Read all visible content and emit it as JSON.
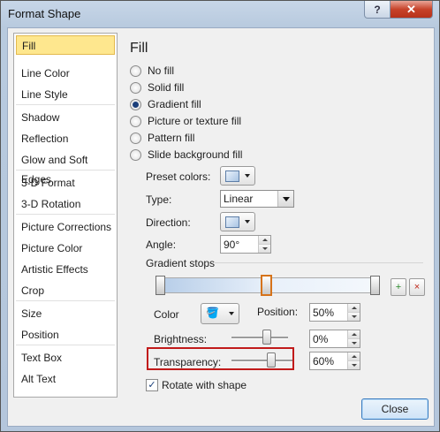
{
  "window": {
    "title": "Format Shape",
    "help_glyph": "?",
    "close_glyph": "✕"
  },
  "nav": {
    "items": [
      {
        "label": "Fill",
        "selected": true
      },
      {
        "label": "Line Color"
      },
      {
        "label": "Line Style"
      },
      {
        "label": "Shadow"
      },
      {
        "label": "Reflection"
      },
      {
        "label": "Glow and Soft Edges"
      },
      {
        "label": "3-D Format"
      },
      {
        "label": "3-D Rotation"
      },
      {
        "label": "Picture Corrections"
      },
      {
        "label": "Picture Color"
      },
      {
        "label": "Artistic Effects"
      },
      {
        "label": "Crop"
      },
      {
        "label": "Size"
      },
      {
        "label": "Position"
      },
      {
        "label": "Text Box"
      },
      {
        "label": "Alt Text"
      }
    ]
  },
  "fill": {
    "heading": "Fill",
    "options": [
      {
        "label": "No fill",
        "selected": false
      },
      {
        "label": "Solid fill",
        "selected": false
      },
      {
        "label": "Gradient fill",
        "selected": true
      },
      {
        "label": "Picture or texture fill",
        "selected": false
      },
      {
        "label": "Pattern fill",
        "selected": false
      },
      {
        "label": "Slide background fill",
        "selected": false
      }
    ],
    "preset_colors_label": "Preset colors:",
    "type_label": "Type:",
    "type_value": "Linear",
    "direction_label": "Direction:",
    "angle_label": "Angle:",
    "angle_value": "90°",
    "gradient_stops_label": "Gradient stops",
    "add_stop_glyph": "+",
    "remove_stop_glyph": "×",
    "color_label": "Color",
    "color_icon_glyph": "🪣",
    "position_label": "Position:",
    "position_value": "50%",
    "brightness_label": "Brightness:",
    "brightness_value": "0%",
    "transparency_label": "Transparency:",
    "transparency_value": "60%",
    "rotate_label": "Rotate with shape",
    "rotate_checked": true,
    "check_glyph": "✓",
    "accent_highlight": "#c11a1a"
  },
  "footer": {
    "close_label": "Close"
  }
}
